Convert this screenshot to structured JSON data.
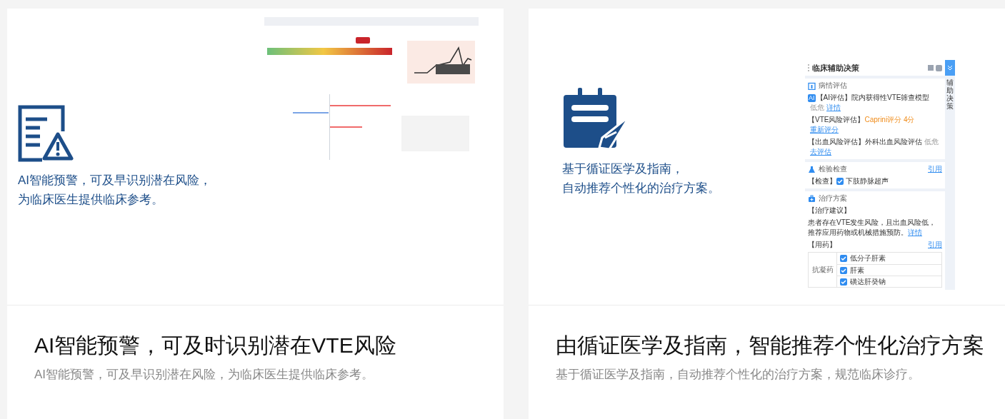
{
  "cards": [
    {
      "kind": "alert",
      "caption_lines": [
        "AI智能预警，可及早识别潜在风险，",
        "为临床医生提供临床参考。"
      ],
      "media": {
        "kind": "picture"
      },
      "title": "AI智能预警，可及时识别潜在VTE风险",
      "subtitle": "AI智能预警，可及早识别潜在风险，为临床医生提供临床参考。"
    },
    {
      "kind": "decision",
      "caption_lines": [
        "基于循证医学及指南，",
        "自动推荐个性化的治疗方案。"
      ],
      "media": {
        "kind": "panel",
        "title": "临床辅助决策",
        "side_tab": "辅助决策",
        "sections": [
          {
            "kind": "assessment",
            "heading": "病情评估",
            "rows": [
              [
                {
                  "kind": "badge",
                  "text": "AI"
                },
                {
                  "kind": "text",
                  "text": "【AI评估】院内获得性VTE筛查模型"
                },
                {
                  "kind": "muted",
                  "text": "低危"
                },
                {
                  "kind": "link",
                  "text": "详情"
                }
              ],
              [
                {
                  "kind": "text",
                  "text": "【VTE风险评估】"
                },
                {
                  "kind": "orange",
                  "text": "Caprini评分 4分"
                },
                {
                  "kind": "link",
                  "text": "重新评分"
                }
              ],
              [
                {
                  "kind": "text",
                  "text": "【出血风险评估】外科出血风险评估"
                },
                {
                  "kind": "muted",
                  "text": "低危"
                },
                {
                  "kind": "link",
                  "text": "去评估"
                }
              ]
            ]
          },
          {
            "kind": "exam",
            "heading": "检验检查",
            "action": "引用",
            "rows": [
              [
                {
                  "kind": "text",
                  "text": "【检查】"
                },
                {
                  "kind": "check",
                  "text": "下肢静脉超声",
                  "checked": true
                }
              ]
            ]
          },
          {
            "kind": "treatment",
            "heading": "治疗方案",
            "label": "【治疗建议】",
            "advice": "患者存在VTE发生风险，且出血风险低，推荐应用药物或机械措施预防。",
            "advice_link": "详情",
            "drug_label": "【用药】",
            "action": "引用",
            "group": "抗凝药",
            "drugs": [
              {
                "name": "低分子肝素",
                "checked": true
              },
              {
                "name": "肝素",
                "checked": true
              },
              {
                "name": "磺达肝癸钠",
                "checked": true
              }
            ]
          }
        ]
      },
      "title": "由循证医学及指南，智能推荐个性化治疗方案",
      "subtitle": "基于循证医学及指南，自动推荐个性化的治疗方案，规范临床诊疗。"
    }
  ]
}
